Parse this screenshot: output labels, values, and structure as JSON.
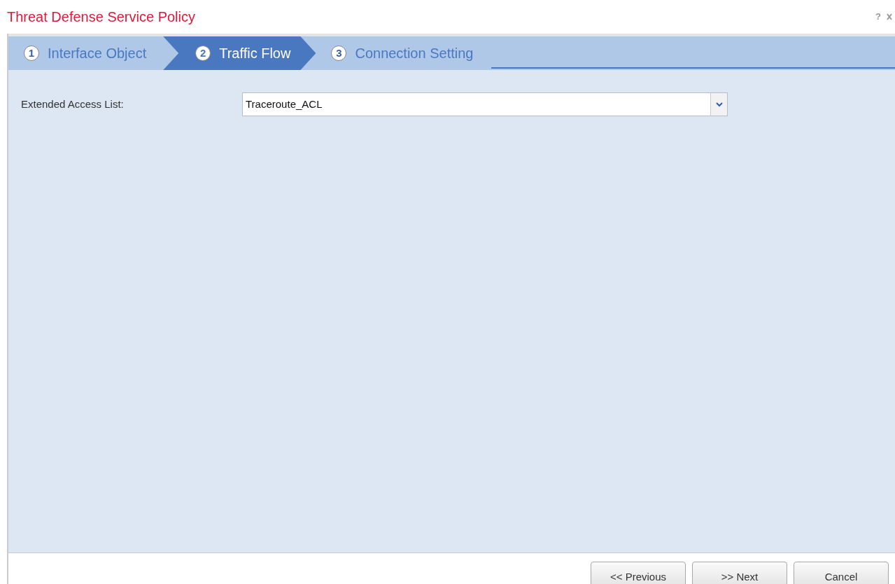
{
  "dialog": {
    "title": "Threat Defense Service Policy",
    "help": "?"
  },
  "steps": [
    {
      "number": "1",
      "label": "Interface Object",
      "selected": false
    },
    {
      "number": "2",
      "label": "Traffic Flow",
      "selected": true
    },
    {
      "number": "3",
      "label": "Connection Setting",
      "selected": false
    }
  ],
  "form": {
    "label": "Extended Access List:",
    "value": "Traceroute_ACL"
  },
  "buttons": [
    "<< Previous",
    ">> Next",
    "Cancel"
  ]
}
